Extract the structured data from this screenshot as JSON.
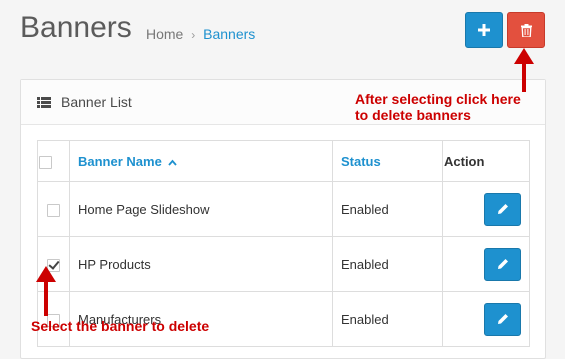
{
  "header": {
    "title": "Banners",
    "breadcrumb": [
      {
        "label": "Home"
      },
      {
        "label": "Banners"
      }
    ],
    "buttons": {
      "add_icon": "plus-icon",
      "delete_icon": "trash-icon"
    }
  },
  "panel": {
    "title": "Banner List",
    "icon": "list-icon"
  },
  "table": {
    "columns": {
      "name": "Banner Name",
      "status": "Status",
      "action": "Action"
    },
    "rows": [
      {
        "name": "Home Page Slideshow",
        "status": "Enabled",
        "selected": false
      },
      {
        "name": "HP Products",
        "status": "Enabled",
        "selected": true
      },
      {
        "name": "Manufacturers",
        "status": "Enabled",
        "selected": false
      }
    ]
  },
  "annotations": {
    "top_line1": "After selecting click here",
    "top_line2": "to delete banners",
    "bottom": "Select the banner to delete"
  },
  "colors": {
    "primary": "#1e91cf",
    "danger": "#e3503e",
    "annotation": "#cc0000"
  }
}
